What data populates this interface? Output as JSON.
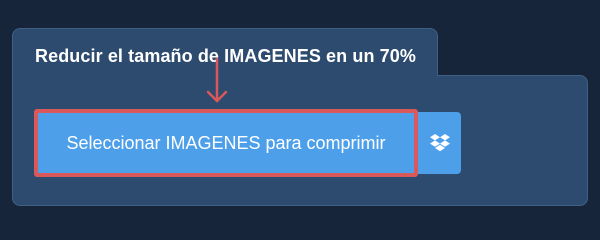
{
  "panel": {
    "title": "Reducir el tamaño de IMAGENES en un 70%"
  },
  "buttons": {
    "select_label": "Seleccionar IMAGENES para comprimir",
    "dropbox_icon": "dropbox-icon"
  },
  "colors": {
    "page_bg": "#162539",
    "panel_bg": "#2d4b6e",
    "button_bg": "#4d9fea",
    "highlight": "#d9595b"
  }
}
